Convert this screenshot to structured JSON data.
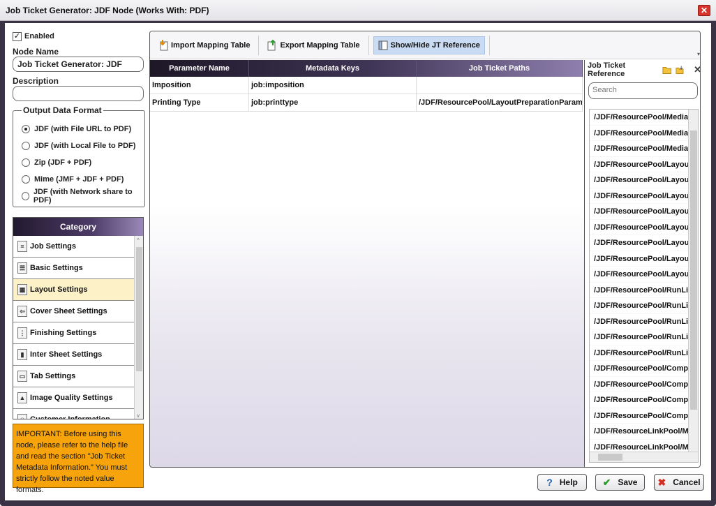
{
  "window": {
    "title": "Job Ticket Generator: JDF Node (Works With: PDF)",
    "close": "✕"
  },
  "left": {
    "enabled_label": "Enabled",
    "enabled_checked": true,
    "node_name_label": "Node Name",
    "node_name_value": "Job Ticket Generator: JDF",
    "description_label": "Description",
    "description_value": "",
    "output_format_label": "Output Data Format",
    "formats": [
      {
        "label": "JDF (with File URL to PDF)",
        "selected": true
      },
      {
        "label": "JDF (with Local File to PDF)",
        "selected": false
      },
      {
        "label": "Zip (JDF + PDF)",
        "selected": false
      },
      {
        "label": "Mime (JMF + JDF + PDF)",
        "selected": false
      },
      {
        "label": "JDF (with Network share to PDF)",
        "selected": false
      }
    ],
    "category_header": "Category",
    "categories": [
      {
        "label": "Job Settings",
        "icon": "document-icon",
        "selected": false
      },
      {
        "label": "Basic Settings",
        "icon": "list-icon",
        "selected": false
      },
      {
        "label": "Layout Settings",
        "icon": "layout-icon",
        "selected": true
      },
      {
        "label": "Cover Sheet Settings",
        "icon": "cover-sheet-icon",
        "selected": false
      },
      {
        "label": "Finishing Settings",
        "icon": "finishing-icon",
        "selected": false
      },
      {
        "label": "Inter Sheet Settings",
        "icon": "inter-sheet-icon",
        "selected": false
      },
      {
        "label": "Tab Settings",
        "icon": "tab-icon",
        "selected": false
      },
      {
        "label": "Image Quality Settings",
        "icon": "image-quality-icon",
        "selected": false
      },
      {
        "label": "Customer Information",
        "icon": "customer-icon",
        "selected": false
      }
    ],
    "notice": "IMPORTANT: Before using this node, please refer to the help file and read the section \"Job Ticket Metadata Information.\" You must strictly follow the noted value formats."
  },
  "toolbar": {
    "import_label": "Import Mapping Table",
    "export_label": "Export Mapping Table",
    "showhide_label": "Show/Hide JT Reference"
  },
  "grid": {
    "headers": [
      "Parameter Name",
      "Metadata Keys",
      "Job Ticket Paths"
    ],
    "rows": [
      [
        "Imposition",
        "job:imposition",
        ""
      ],
      [
        "Printing Type",
        "job:printtype",
        "/JDF/ResourcePool/LayoutPreparationParams/@Sides"
      ]
    ]
  },
  "jt_reference": {
    "title": "Job Ticket Reference",
    "search_placeholder": "Search",
    "items": [
      "/JDF/ResourcePool/Media/@Cl",
      "/JDF/ResourcePool/Media/@ID",
      "/JDF/ResourcePool/Media/@St",
      "/JDF/ResourcePool/LayoutPrep",
      "/JDF/ResourcePool/LayoutPrep",
      "/JDF/ResourcePool/LayoutPrep",
      "/JDF/ResourcePool/LayoutPrep",
      "/JDF/ResourcePool/LayoutPrep",
      "/JDF/ResourcePool/LayoutPrep",
      "/JDF/ResourcePool/LayoutPrep",
      "/JDF/ResourcePool/LayoutPrep",
      "/JDF/ResourcePool/RunList/@C",
      "/JDF/ResourcePool/RunList/@I",
      "/JDF/ResourcePool/RunList/@N",
      "/JDF/ResourcePool/RunList/@S",
      "/JDF/ResourcePool/RunList/Lay",
      "/JDF/ResourcePool/Componen",
      "/JDF/ResourcePool/Componen",
      "/JDF/ResourcePool/Componen",
      "/JDF/ResourcePool/Componen",
      "/JDF/ResourceLinkPool/Medial",
      "/JDF/ResourceLinkPool/Medial"
    ]
  },
  "footer": {
    "help_label": "Help",
    "save_label": "Save",
    "cancel_label": "Cancel"
  }
}
